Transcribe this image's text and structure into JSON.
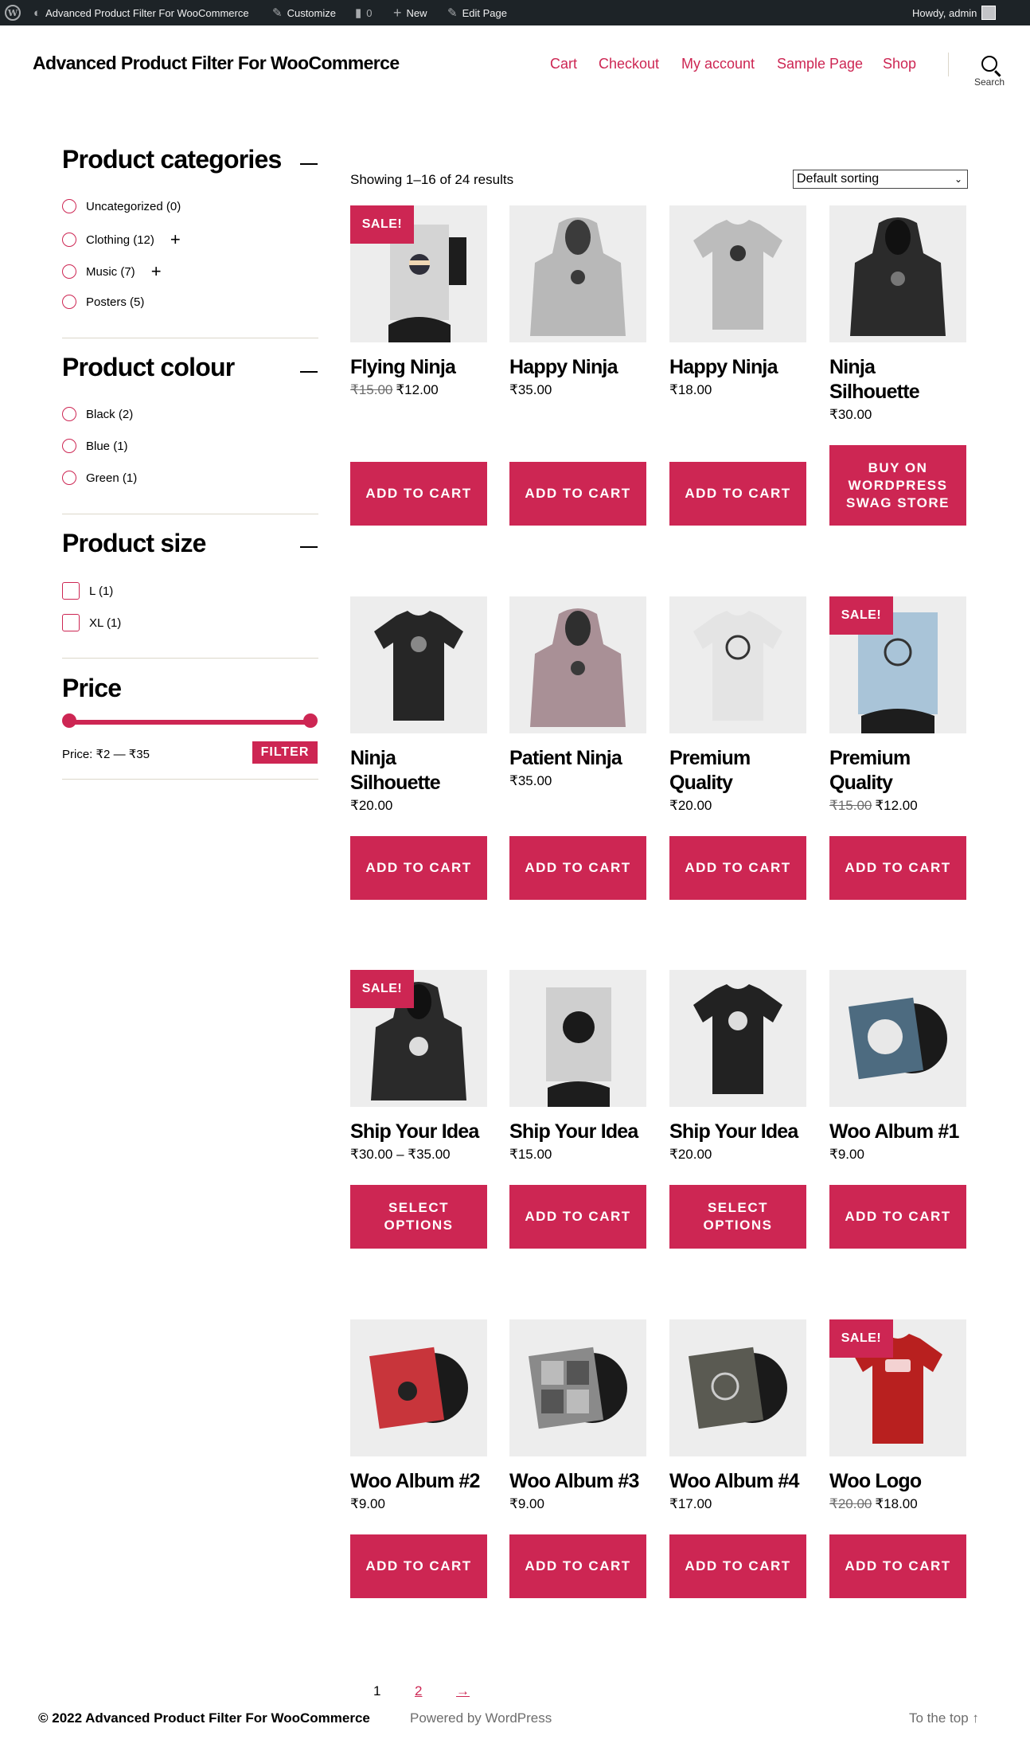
{
  "admin_bar": {
    "site_name": "Advanced Product Filter For WooCommerce",
    "customize": "Customize",
    "comments_count": "0",
    "new": "New",
    "edit_page": "Edit Page",
    "greeting": "Howdy, admin"
  },
  "header": {
    "site_title": "Advanced Product Filter For WooCommerce",
    "nav": [
      "Cart",
      "Checkout",
      "My account",
      "Sample Page",
      "Shop"
    ],
    "search_label": "Search"
  },
  "sidebar": {
    "categories": {
      "title": "Product categories",
      "items": [
        {
          "label": "Uncategorized",
          "count": "(0)"
        },
        {
          "label": "Clothing",
          "count": "(12)"
        },
        {
          "label": "Music",
          "count": "(7)"
        },
        {
          "label": "Posters",
          "count": "(5)"
        }
      ]
    },
    "colour": {
      "title": "Product colour",
      "items": [
        {
          "label": "Black",
          "count": "(2)"
        },
        {
          "label": "Blue",
          "count": "(1)"
        },
        {
          "label": "Green",
          "count": "(1)"
        }
      ]
    },
    "size": {
      "title": "Product size",
      "items": [
        {
          "label": "L",
          "count": "(1)"
        },
        {
          "label": "XL",
          "count": "(1)"
        }
      ]
    },
    "price": {
      "title": "Price",
      "range_text": "Price: ₹2 — ₹35",
      "filter_button": "FILTER",
      "min_fraction": 0,
      "max_fraction": 1
    }
  },
  "results": {
    "count_text": "Showing 1–16 of 24 results",
    "sort_selected": "Default sorting"
  },
  "products": [
    {
      "title": "Flying Ninja",
      "old_price": "₹15.00",
      "price": "₹12.00",
      "sale": "SALE!",
      "button": "ADD TO CART"
    },
    {
      "title": "Happy Ninja",
      "old_price": "",
      "price": "₹35.00",
      "sale": "",
      "button": "ADD TO CART"
    },
    {
      "title": "Happy Ninja",
      "old_price": "",
      "price": "₹18.00",
      "sale": "",
      "button": "ADD TO CART"
    },
    {
      "title": "Ninja Silhouette",
      "old_price": "",
      "price": "₹30.00",
      "sale": "",
      "button": "BUY ON WORDPRESS SWAG STORE"
    },
    {
      "title": "Ninja Silhouette",
      "old_price": "",
      "price": "₹20.00",
      "sale": "",
      "button": "ADD TO CART"
    },
    {
      "title": "Patient Ninja",
      "old_price": "",
      "price": "₹35.00",
      "sale": "",
      "button": "ADD TO CART"
    },
    {
      "title": "Premium Quality",
      "old_price": "",
      "price": "₹20.00",
      "sale": "",
      "button": "ADD TO CART"
    },
    {
      "title": "Premium Quality",
      "old_price": "₹15.00",
      "price": "₹12.00",
      "sale": "SALE!",
      "button": "ADD TO CART"
    },
    {
      "title": "Ship Your Idea",
      "old_price": "",
      "price": "₹30.00 – ₹35.00",
      "sale": "SALE!",
      "button": "SELECT OPTIONS"
    },
    {
      "title": "Ship Your Idea",
      "old_price": "",
      "price": "₹15.00",
      "sale": "",
      "button": "ADD TO CART"
    },
    {
      "title": "Ship Your Idea",
      "old_price": "",
      "price": "₹20.00",
      "sale": "",
      "button": "SELECT OPTIONS"
    },
    {
      "title": "Woo Album #1",
      "old_price": "",
      "price": "₹9.00",
      "sale": "",
      "button": "ADD TO CART"
    },
    {
      "title": "Woo Album #2",
      "old_price": "",
      "price": "₹9.00",
      "sale": "",
      "button": "ADD TO CART"
    },
    {
      "title": "Woo Album #3",
      "old_price": "",
      "price": "₹9.00",
      "sale": "",
      "button": "ADD TO CART"
    },
    {
      "title": "Woo Album #4",
      "old_price": "",
      "price": "₹17.00",
      "sale": "",
      "button": "ADD TO CART"
    },
    {
      "title": "Woo Logo",
      "old_price": "₹20.00",
      "price": "₹18.00",
      "sale": "SALE!",
      "button": "ADD TO CART"
    }
  ],
  "pagination": {
    "current": "1",
    "next_page": "2",
    "next_arrow": "→"
  },
  "footer": {
    "copyright": "© 2022 Advanced Product Filter For WooCommerce",
    "powered": "Powered by WordPress",
    "to_top": "To the top ↑"
  },
  "colors": {
    "accent": "#cd2653",
    "adminbar": "#1d2327"
  }
}
